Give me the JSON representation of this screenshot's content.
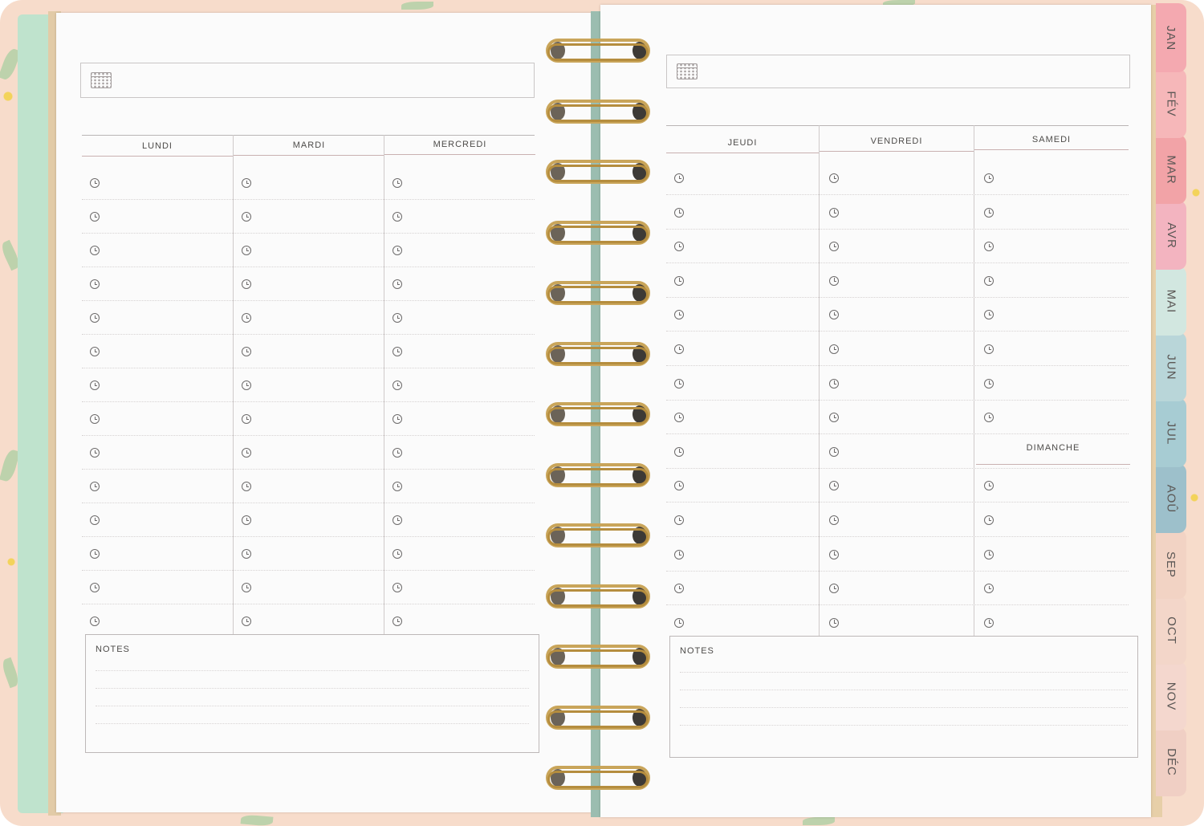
{
  "planner": {
    "left_page": {
      "days": [
        "LUNDI",
        "MARDI",
        "MERCREDI"
      ],
      "notes_label": "NOTES"
    },
    "right_page": {
      "days": [
        "JEUDI",
        "VENDREDI",
        "SAMEDI"
      ],
      "sunday_label": "DIMANCHE",
      "notes_label": "NOTES"
    },
    "month_tabs": [
      {
        "label": "JAN",
        "color": "#f4a9b0"
      },
      {
        "label": "FÉV",
        "color": "#f6b7b9"
      },
      {
        "label": "MAR",
        "color": "#f2a3a7"
      },
      {
        "label": "AVR",
        "color": "#f3b4c0"
      },
      {
        "label": "MAI",
        "color": "#d2e7e0"
      },
      {
        "label": "JUN",
        "color": "#b9d6d9"
      },
      {
        "label": "JUL",
        "color": "#a7ccd3"
      },
      {
        "label": "AOÛ",
        "color": "#9dc0cb"
      },
      {
        "label": "SEP",
        "color": "#f2d3c4"
      },
      {
        "label": "OCT",
        "color": "#f3d6c9"
      },
      {
        "label": "NOV",
        "color": "#f4d7ce"
      },
      {
        "label": "DÉC",
        "color": "#f0cfc4"
      }
    ]
  }
}
